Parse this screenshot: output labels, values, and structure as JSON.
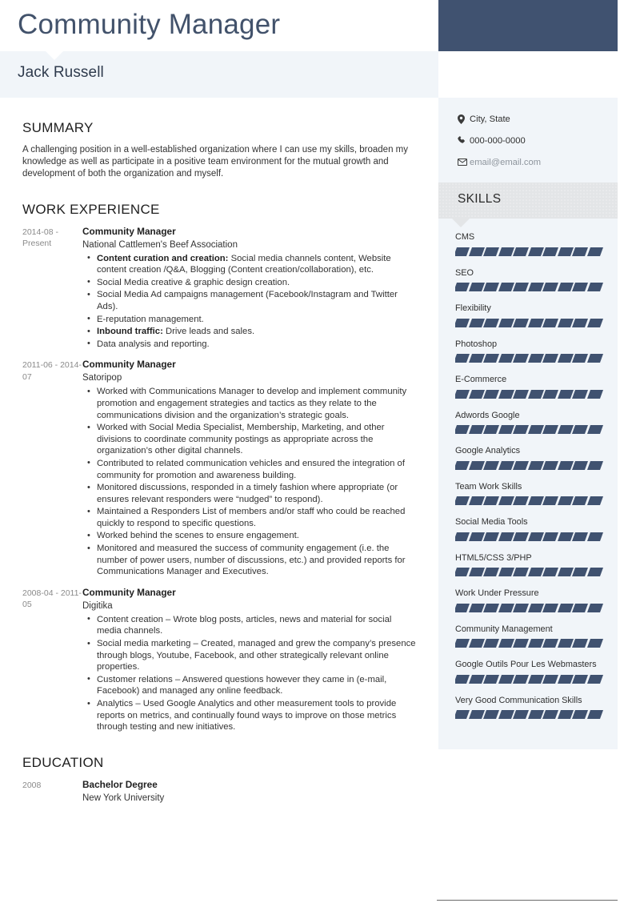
{
  "theme": {
    "accent_dark": "#405270",
    "sidebar_bg": "#f1f5f9",
    "skills_header_bg": "#e3e5e7",
    "text_primary": "#1f1f1f",
    "text_muted": "#8a8a8a"
  },
  "header": {
    "title": "Community Manager"
  },
  "name_band": {
    "name": "Jack Russell"
  },
  "summary": {
    "heading": "SUMMARY",
    "text": "A challenging position in a well-established organization where I can use my skills, broaden my knowledge as well as participate in a positive team environment for the mutual growth and development of both the organization and myself."
  },
  "work_experience": {
    "heading": "WORK EXPERIENCE",
    "items": [
      {
        "dates": "2014-08 - Present",
        "role": "Community Manager",
        "company": "National Cattlemen's Beef Association",
        "bullets": [
          {
            "bold": "Content curation and creation:",
            "text": " Social media channels content, Website content creation /Q&A, Blogging (Content creation/collaboration), etc."
          },
          {
            "bold": "",
            "text": "Social Media creative & graphic design creation."
          },
          {
            "bold": "",
            "text": "Social Media Ad campaigns management (Facebook/Instagram and Twitter Ads)."
          },
          {
            "bold": "",
            "text": "E-reputation management."
          },
          {
            "bold": "Inbound traffic:",
            "text": " Drive leads and sales."
          },
          {
            "bold": "",
            "text": "Data analysis and reporting."
          }
        ]
      },
      {
        "dates": "2011-06 - 2014-07",
        "role": "Community Manager",
        "company": "Satoripop",
        "bullets": [
          {
            "bold": "",
            "text": "Worked with Communications Manager to develop and implement community promotion and engagement strategies and tactics as they relate to the communications division and the organization’s strategic goals."
          },
          {
            "bold": "",
            "text": "Worked with Social Media Specialist, Membership, Marketing, and other divisions to coordinate community postings as appropriate across the organization’s other digital channels."
          },
          {
            "bold": "",
            "text": "Contributed to related communication vehicles and ensured the integration of community for promotion and awareness building."
          },
          {
            "bold": "",
            "text": "Monitored discussions, responded in a timely fashion where appropriate (or ensures relevant responders were “nudged” to respond)."
          },
          {
            "bold": "",
            "text": "Maintained a Responders List of members and/or staff who could be reached quickly to respond to specific questions."
          },
          {
            "bold": "",
            "text": "Worked behind the scenes to ensure engagement."
          },
          {
            "bold": "",
            "text": "Monitored and measured the success of community engagement (i.e. the number of power users, number of discussions, etc.) and provided reports for Communications Manager and Executives."
          }
        ]
      },
      {
        "dates": "2008-04 - 2011-05",
        "role": "Community Manager",
        "company": "Digitika",
        "bullets": [
          {
            "bold": "",
            "text": "Content creation – Wrote blog posts, articles, news and material for social media channels."
          },
          {
            "bold": "",
            "text": "Social media marketing – Created, managed and grew the company’s presence through blogs, Youtube, Facebook, and other strategically relevant online properties."
          },
          {
            "bold": "",
            "text": "Customer relations – Answered questions however they came in (e-mail, Facebook) and managed any online feedback."
          },
          {
            "bold": "",
            "text": "Analytics – Used Google Analytics and other measurement tools to provide reports on metrics, and continually found ways to improve on those metrics through testing and new initiatives."
          }
        ]
      }
    ]
  },
  "education": {
    "heading": "EDUCATION",
    "items": [
      {
        "dates": "2008",
        "degree": "Bachelor Degree",
        "school": "New York University"
      }
    ]
  },
  "sidebar": {
    "contact": [
      {
        "icon": "location-pin-icon",
        "text": "City, State",
        "muted": false
      },
      {
        "icon": "phone-icon",
        "text": "000-000-0000",
        "muted": false
      },
      {
        "icon": "envelope-icon",
        "text": "email@email.com",
        "muted": true
      }
    ],
    "skills_heading": "SKILLS",
    "skill_segments_total": 10,
    "skills": [
      {
        "label": "CMS",
        "filled": 10
      },
      {
        "label": "SEO",
        "filled": 10
      },
      {
        "label": "Flexibility",
        "filled": 10
      },
      {
        "label": "Photoshop",
        "filled": 10
      },
      {
        "label": "E-Commerce",
        "filled": 10
      },
      {
        "label": "Adwords Google",
        "filled": 10
      },
      {
        "label": "Google Analytics",
        "filled": 10
      },
      {
        "label": "Team Work Skills",
        "filled": 10
      },
      {
        "label": "Social Media Tools",
        "filled": 10
      },
      {
        "label": "HTML5/CSS 3/PHP",
        "filled": 10
      },
      {
        "label": "Work Under Pressure",
        "filled": 10
      },
      {
        "label": "Community Management",
        "filled": 10
      },
      {
        "label": "Google Outils Pour Les Webmasters",
        "filled": 10
      },
      {
        "label": "Very Good Communication Skills",
        "filled": 10
      }
    ]
  }
}
